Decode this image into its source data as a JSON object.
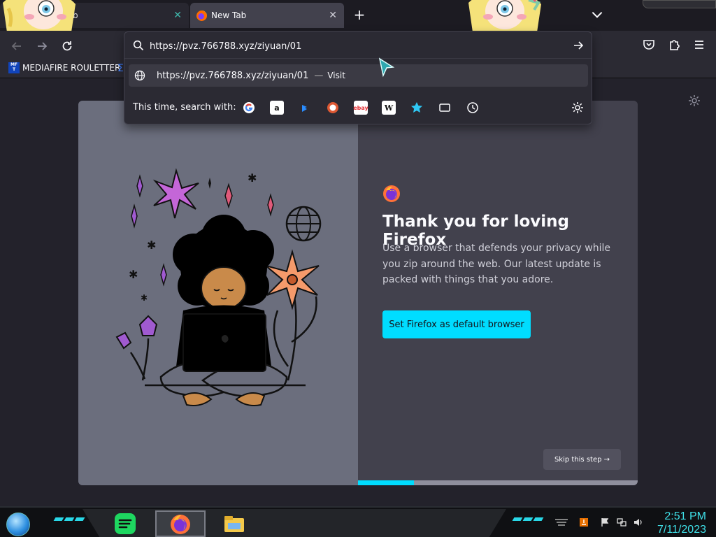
{
  "tabs": [
    {
      "label": "b",
      "close_glyph": "✕",
      "active": false
    },
    {
      "label": "New Tab",
      "close_glyph": "✕",
      "active": true
    }
  ],
  "tabstrip": {
    "new_tab_glyph": "+"
  },
  "bookmarks": [
    {
      "label": "MEDIAFIRE ROULETTER",
      "icon_text": "MF T"
    }
  ],
  "urlbar": {
    "value": "https://pvz.766788.xyz/ziyuan/01",
    "suggestion": {
      "url": "https://pvz.766788.xyz/ziyuan/01",
      "separator": "—",
      "action": "Visit"
    },
    "search_with_label": "This time, search with:",
    "engines": [
      "google",
      "amazon",
      "bing",
      "duckduckgo",
      "ebay",
      "wikipedia",
      "bookmarks",
      "tabs",
      "history"
    ]
  },
  "onboarding": {
    "headline": "Thank you for loving Firefox",
    "body": "Use a browser that defends your privacy while you zip around the web. Our latest update is packed with things that you adore.",
    "primary_button": "Set Firefox as default browser",
    "skip_button": "Skip this step",
    "skip_arrow": "→",
    "progress": 0.2
  },
  "taskbar": {
    "time": "2:51 PM",
    "date": "7/11/2023",
    "apps": [
      "spotify",
      "firefox",
      "file-explorer"
    ]
  },
  "colors": {
    "accent": "#00ddff",
    "clock": "#3fe0e8",
    "background": "#1c1b22"
  }
}
